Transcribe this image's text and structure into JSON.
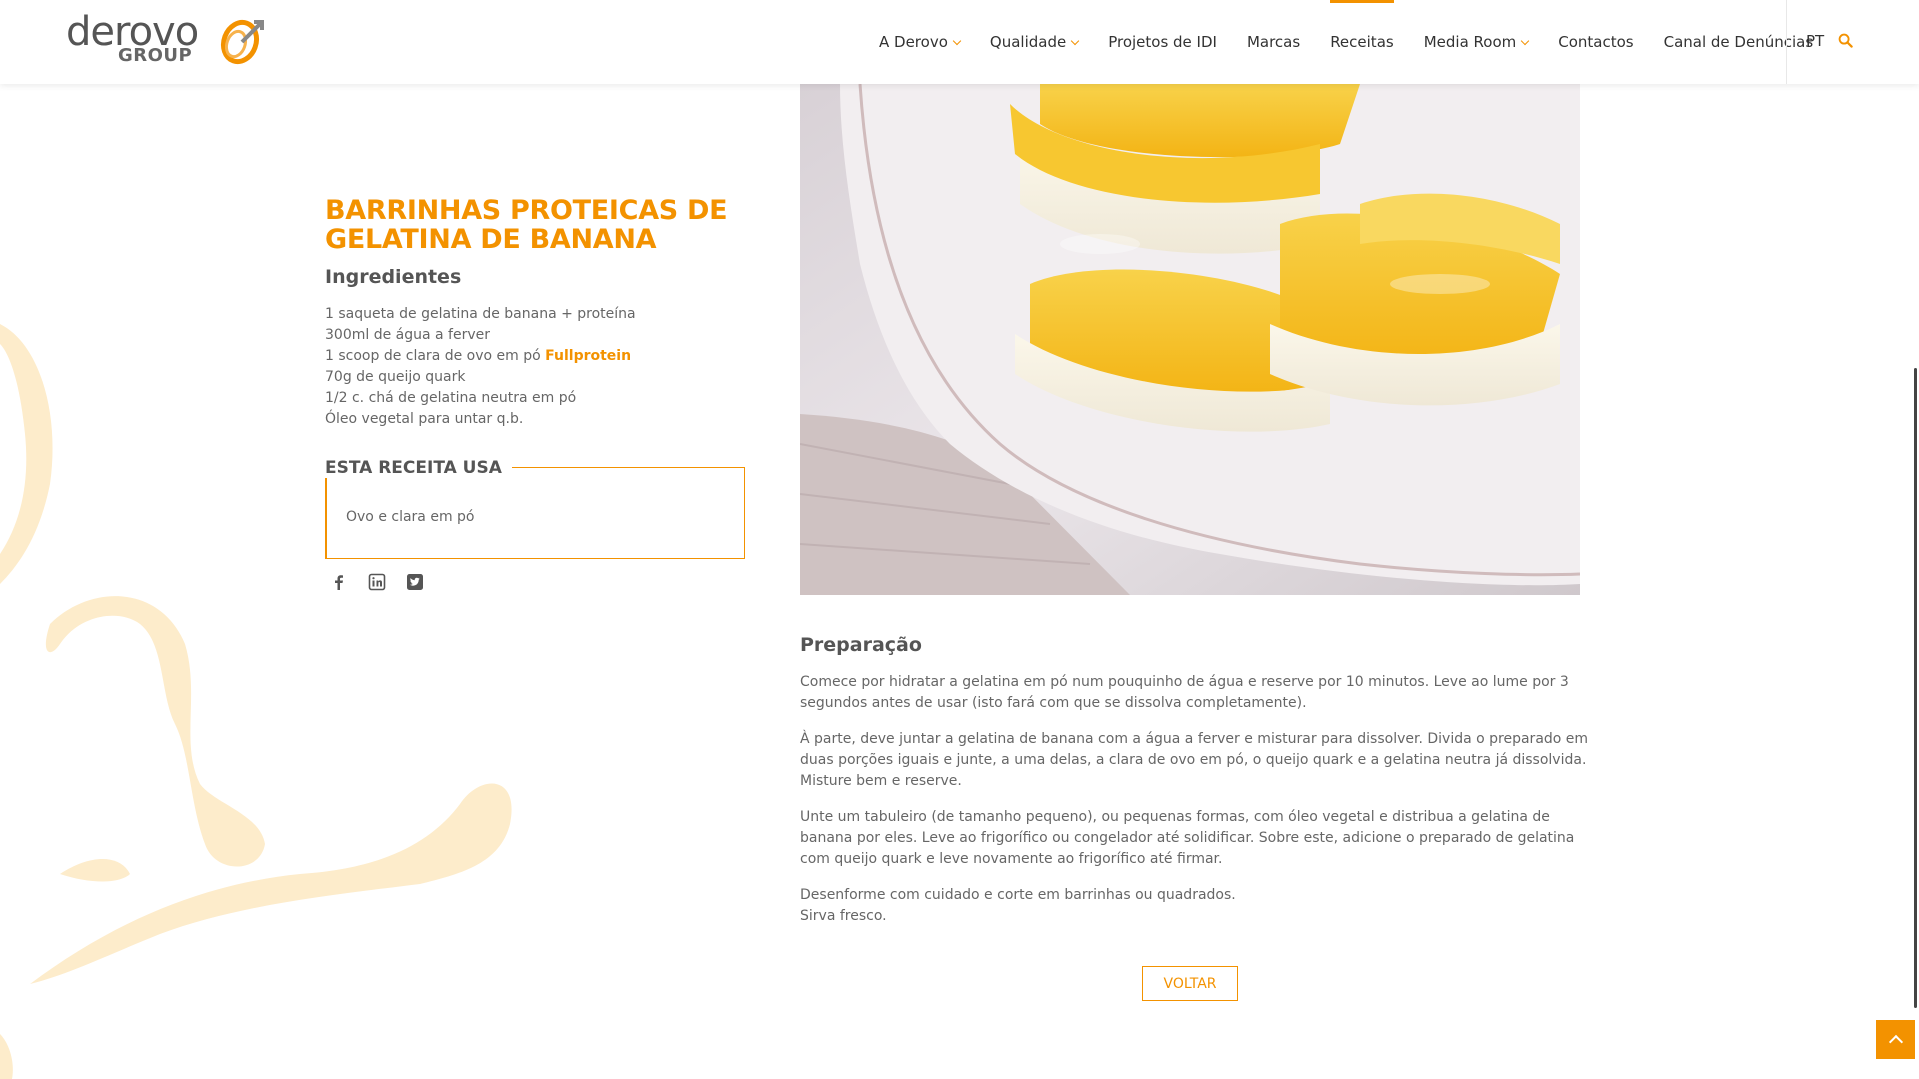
{
  "header": {
    "logo_text": "derovo",
    "logo_group": "GROUP",
    "nav": [
      {
        "label": "A Derovo",
        "dropdown": true
      },
      {
        "label": "Qualidade",
        "dropdown": true
      },
      {
        "label": "Projetos de IDI",
        "dropdown": false
      },
      {
        "label": "Marcas",
        "dropdown": false
      },
      {
        "label": "Receitas",
        "dropdown": false,
        "active": true
      },
      {
        "label": "Media Room",
        "dropdown": true
      },
      {
        "label": "Contactos",
        "dropdown": false
      },
      {
        "label": "Canal de Denúncias",
        "dropdown": false
      }
    ],
    "language": "PT",
    "search_icon": "search-icon"
  },
  "recipe": {
    "title": "BARRINHAS PROTEICAS DE GELATINA DE BANANA",
    "ingredients_heading": "Ingredientes",
    "ingredients": [
      {
        "text": "1 saqueta de gelatina de banana + proteína"
      },
      {
        "text": "300ml de água a ferver"
      },
      {
        "text": "1 scoop de clara de ovo em pó ",
        "link": "Fullprotein"
      },
      {
        "text": "70g de queijo quark"
      },
      {
        "text": "1/2 c. chá de gelatina neutra em pó"
      },
      {
        "text": "Óleo vegetal para untar q.b."
      }
    ],
    "uses_heading": "ESTA RECEITA USA",
    "uses_item": "Ovo e clara em pó",
    "social": [
      "facebook-icon",
      "linkedin-icon",
      "twitter-icon"
    ],
    "preparation_heading": "Preparação",
    "preparation": [
      [
        "Comece por hidratar a gelatina em pó num pouquinho de água e reserve por 10 minutos. Leve ao lume por 3 segundos antes de usar (isto fará com que se dissolva completamente)."
      ],
      [
        "À parte, deve juntar a gelatina de banana com a água a ferver e misturar para dissolver. Divida o preparado em duas porções iguais e junte, a uma delas, a clara de ovo em pó, o queijo quark e a gelatina neutra já dissolvida.",
        "Misture bem e reserve."
      ],
      [
        "Unte um tabuleiro (de tamanho pequeno), ou pequenas formas, com óleo vegetal e distribua a gelatina de banana por eles. Leve ao frigorífico ou congelador até solidificar. Sobre este, adicione o preparado de gelatina com queijo quark e leve novamente ao frigorífico até firmar."
      ],
      [
        "Desenforme com cuidado e corte em barrinhas ou quadrados.",
        "Sirva fresco."
      ]
    ],
    "back_label": "VOLTAR"
  },
  "colors": {
    "accent": "#f39200",
    "text": "#666666",
    "heading": "#555555",
    "swirl": "#fdeccb"
  }
}
